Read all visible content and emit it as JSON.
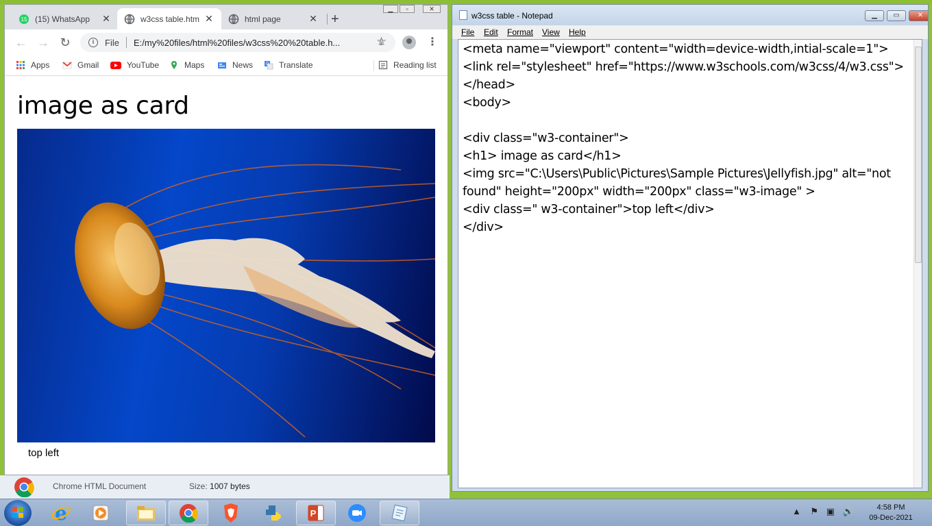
{
  "chrome": {
    "tabs": [
      {
        "title": "(15) WhatsApp",
        "badge": "15"
      },
      {
        "title": "w3css  table.htm"
      },
      {
        "title": "html page"
      }
    ],
    "new_tab": "+",
    "omnibox": {
      "scheme_label": "File",
      "url": "E:/my%20files/html%20files/w3css%20%20table.h..."
    },
    "bookmarks": [
      "Apps",
      "Gmail",
      "YouTube",
      "Maps",
      "News",
      "Translate"
    ],
    "reading_list": "Reading list",
    "page": {
      "heading": "image as card",
      "caption": "top left"
    }
  },
  "download_bar": {
    "file_type": "Chrome HTML Document",
    "size_label": "Size:",
    "size_value": "1007 bytes"
  },
  "notepad": {
    "title": "w3css  table - Notepad",
    "menus": [
      "File",
      "Edit",
      "Format",
      "View",
      "Help"
    ],
    "lines": [
      "<meta name=\"viewport\" content=\"width=device-width,intial-scale=1\">",
      "<link rel=\"stylesheet\" href=\"https://www.w3schools.com/w3css/4/w3.css\">",
      "</head>",
      "<body>",
      "",
      "<div class=\"w3-container\">",
      "<h1> image as card</h1>",
      "<img src=\"C:\\Users\\Public\\Pictures\\Sample Pictures\\Jellyfish.jpg\" alt=\"not",
      "found\" height=\"200px\" width=\"200px\" class=\"w3-image\" >",
      "<div class=\" w3-container\">top left</div>",
      "</div>"
    ]
  },
  "taskbar": {
    "apps": [
      "start-button",
      "internet-explorer",
      "media-player",
      "file-explorer",
      "chrome",
      "brave",
      "python",
      "powerpoint",
      "zoom",
      "notepad"
    ],
    "clock": {
      "time": "4:58 PM",
      "date": "09-Dec-2021"
    }
  },
  "colors": {
    "desktop": "#8fc13a",
    "tab_strip": "#dee1e6",
    "notepad_frame": "#cfdcec",
    "taskbar": "#9bb2d0"
  }
}
